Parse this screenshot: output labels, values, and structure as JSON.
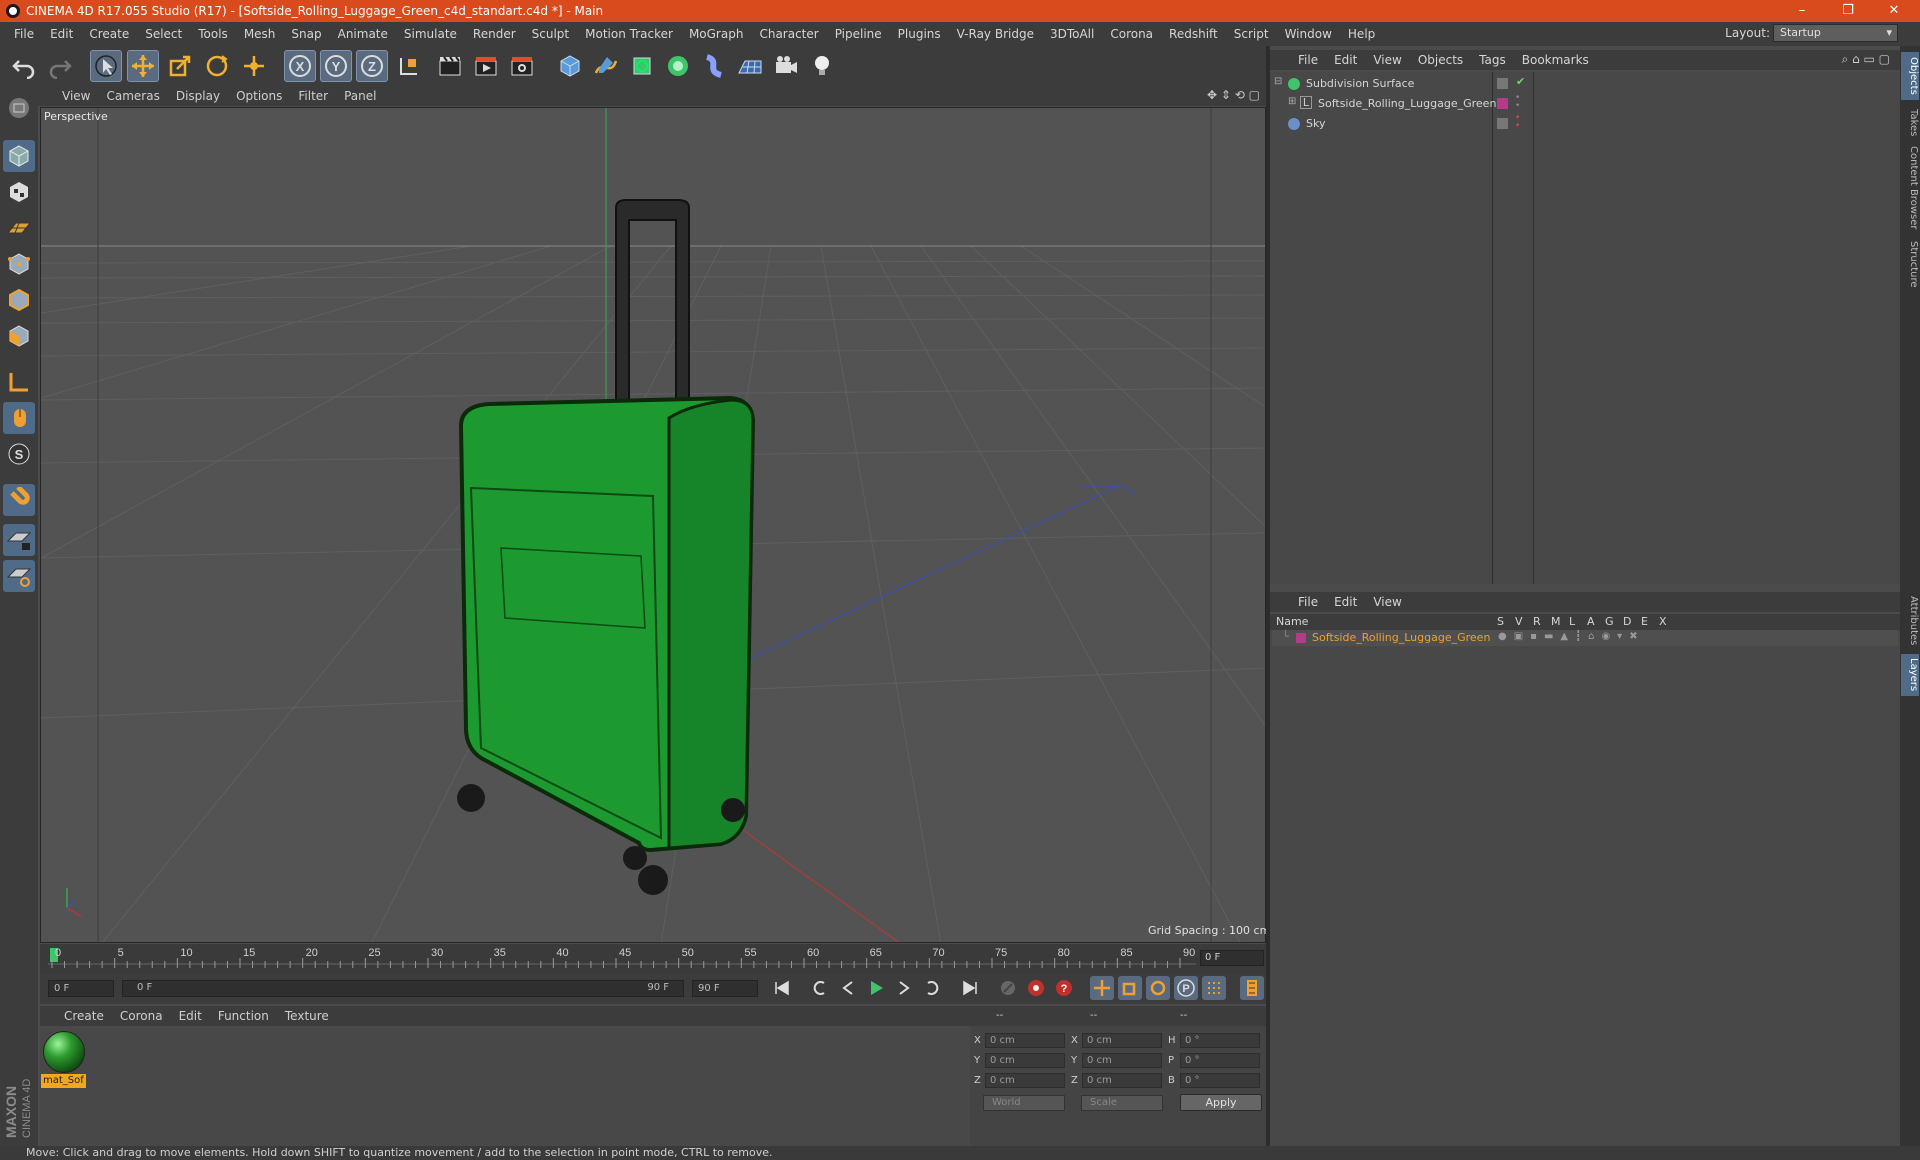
{
  "titlebar": {
    "title": "CINEMA 4D R17.055 Studio (R17) - [Softside_Rolling_Luggage_Green_c4d_standart.c4d *] - Main",
    "minimize": "–",
    "restore": "❐",
    "close": "✕"
  },
  "menu": [
    "File",
    "Edit",
    "Create",
    "Select",
    "Tools",
    "Mesh",
    "Snap",
    "Animate",
    "Simulate",
    "Render",
    "Sculpt",
    "Motion Tracker",
    "MoGraph",
    "Character",
    "Pipeline",
    "Plugins",
    "V-Ray Bridge",
    "3DToAll",
    "Corona",
    "Redshift",
    "Script",
    "Window",
    "Help"
  ],
  "layout": {
    "label": "Layout:",
    "value": "Startup"
  },
  "viewport": {
    "menu": [
      "View",
      "Cameras",
      "Display",
      "Options",
      "Filter",
      "Panel"
    ],
    "camera_label": "Perspective",
    "grid_spacing": "Grid Spacing : 100 cm"
  },
  "timeline": {
    "ticks": [
      "0",
      "5",
      "10",
      "15",
      "20",
      "25",
      "30",
      "35",
      "40",
      "45",
      "50",
      "55",
      "60",
      "65",
      "70",
      "75",
      "80",
      "85",
      "90"
    ],
    "current_frame": "0 F",
    "start_field": "0 F",
    "range_start": "0 F",
    "range_end": "90 F",
    "end_field": "90 F"
  },
  "materials": {
    "menu": [
      "Create",
      "Corona",
      "Edit",
      "Function",
      "Texture"
    ],
    "items": [
      {
        "name": "mat_Sof",
        "color": "#2e9a2e"
      }
    ]
  },
  "coordinates": {
    "headers": [
      "--",
      "--",
      "--"
    ],
    "rows": [
      {
        "a": "X",
        "av": "0 cm",
        "b": "X",
        "bv": "0 cm",
        "c": "H",
        "cv": "0 °"
      },
      {
        "a": "Y",
        "av": "0 cm",
        "b": "Y",
        "bv": "0 cm",
        "c": "P",
        "cv": "0 °"
      },
      {
        "a": "Z",
        "av": "0 cm",
        "b": "Z",
        "bv": "0 cm",
        "c": "B",
        "cv": "0 °"
      }
    ],
    "mode": "World",
    "transform": "Scale",
    "apply": "Apply"
  },
  "objects": {
    "menu": [
      "File",
      "Edit",
      "View",
      "Objects",
      "Tags",
      "Bookmarks"
    ],
    "items": [
      {
        "name": "Subdivision Surface",
        "icon": "subdivision-icon",
        "color": "#3ec46a"
      },
      {
        "name": "Softside_Rolling_Luggage_Green",
        "icon": "layer-object-icon",
        "color": "#b53a8a"
      },
      {
        "name": "Sky",
        "icon": "sky-icon",
        "color": "#6d8fc9"
      }
    ]
  },
  "layers": {
    "menu": [
      "File",
      "Edit",
      "View"
    ],
    "columns": [
      "Name",
      "S",
      "V",
      "R",
      "M",
      "L",
      "A",
      "G",
      "D",
      "E",
      "X"
    ],
    "items": [
      {
        "name": "Softside_Rolling_Luggage_Green",
        "color": "#b53a8a"
      }
    ]
  },
  "right_tabs": [
    "Objects",
    "Takes",
    "Content Browser",
    "Structure",
    "Attributes",
    "Layers"
  ],
  "status": "Move: Click and drag to move elements. Hold down SHIFT to quantize movement / add to the selection in point mode, CTRL to remove.",
  "brand": {
    "line1": "MAXON",
    "line2": "CINEMA 4D"
  },
  "accent": "#d94a1c"
}
